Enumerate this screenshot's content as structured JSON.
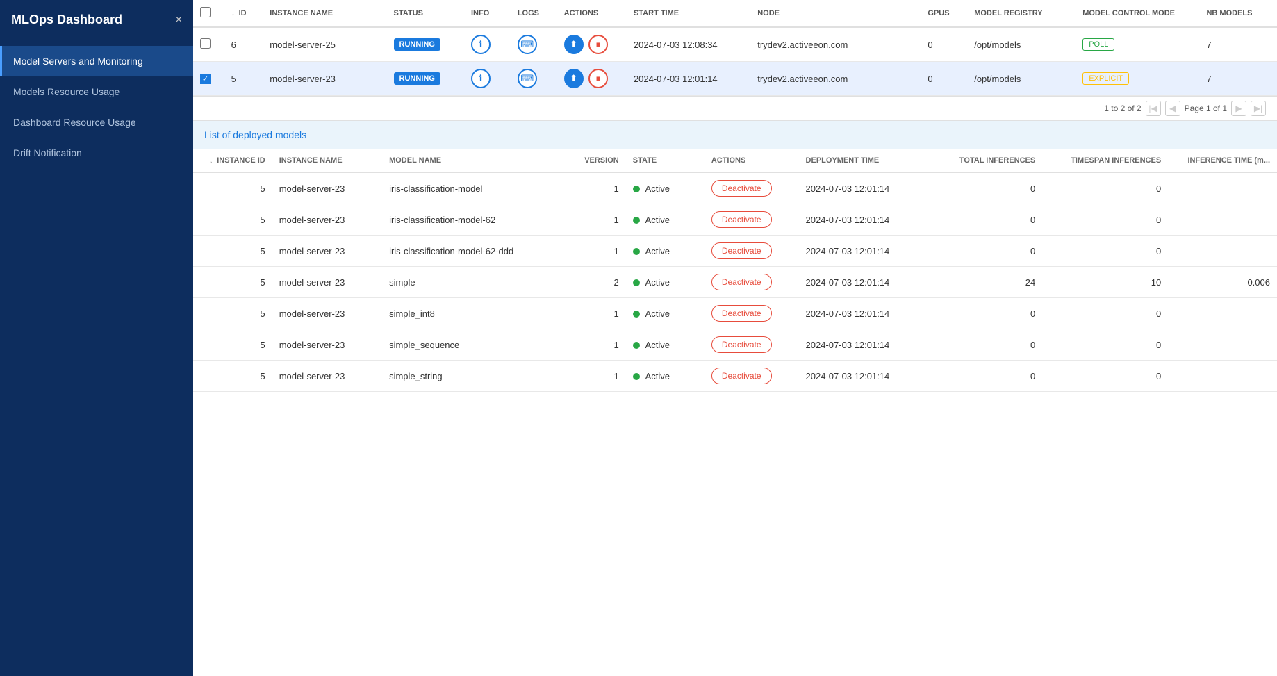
{
  "sidebar": {
    "title": "MLOps Dashboard",
    "close_label": "×",
    "items": [
      {
        "id": "model-servers",
        "label": "Model Servers and Monitoring",
        "active": true
      },
      {
        "id": "models-resource",
        "label": "Models Resource Usage",
        "active": false
      },
      {
        "id": "dashboard-resource",
        "label": "Dashboard Resource Usage",
        "active": false
      },
      {
        "id": "drift-notification",
        "label": "Drift Notification",
        "active": false
      }
    ]
  },
  "top_table": {
    "columns": [
      {
        "id": "checkbox",
        "label": ""
      },
      {
        "id": "id",
        "label": "ID",
        "sortable": true
      },
      {
        "id": "instance_name",
        "label": "INSTANCE NAME"
      },
      {
        "id": "status",
        "label": "STATUS"
      },
      {
        "id": "info",
        "label": "INFO"
      },
      {
        "id": "logs",
        "label": "LOGS"
      },
      {
        "id": "actions",
        "label": "ACTIONS"
      },
      {
        "id": "start_time",
        "label": "START TIME"
      },
      {
        "id": "node",
        "label": "NODE"
      },
      {
        "id": "gpus",
        "label": "GPUS"
      },
      {
        "id": "model_registry",
        "label": "MODEL REGISTRY"
      },
      {
        "id": "control_mode",
        "label": "MODEL CONTROL MODE"
      },
      {
        "id": "nb_models",
        "label": "NB MODELS"
      }
    ],
    "rows": [
      {
        "id": 6,
        "instance_name": "model-server-25",
        "status": "RUNNING",
        "start_time": "2024-07-03 12:08:34",
        "node": "trydev2.activeeon.com",
        "gpus": 0,
        "model_registry": "/opt/models",
        "control_mode": "POLL",
        "control_mode_type": "poll",
        "nb_models": 7,
        "selected": false
      },
      {
        "id": 5,
        "instance_name": "model-server-23",
        "status": "RUNNING",
        "start_time": "2024-07-03 12:01:14",
        "node": "trydev2.activeeon.com",
        "gpus": 0,
        "model_registry": "/opt/models",
        "control_mode": "EXPLICIT",
        "control_mode_type": "explicit",
        "nb_models": 7,
        "selected": true
      }
    ],
    "pagination": {
      "range": "1 to 2 of 2",
      "page_label": "Page 1 of 1"
    }
  },
  "deployed_models": {
    "section_title": "List of deployed models",
    "columns": [
      {
        "id": "instance_id",
        "label": "INSTANCE ID",
        "sortable": true
      },
      {
        "id": "instance_name",
        "label": "INSTANCE NAME"
      },
      {
        "id": "model_name",
        "label": "MODEL NAME"
      },
      {
        "id": "version",
        "label": "VERSION"
      },
      {
        "id": "state",
        "label": "STATE"
      },
      {
        "id": "actions",
        "label": "ACTIONS"
      },
      {
        "id": "deployment_time",
        "label": "DEPLOYMENT TIME"
      },
      {
        "id": "total_inferences",
        "label": "TOTAL INFERENCES"
      },
      {
        "id": "timespan_inferences",
        "label": "TIMESPAN INFERENCES"
      },
      {
        "id": "inference_time",
        "label": "INFERENCE TIME (m..."
      }
    ],
    "rows": [
      {
        "instance_id": 5,
        "instance_name": "model-server-23",
        "model_name": "iris-classification-model",
        "version": 1,
        "state": "Active",
        "deployment_time": "2024-07-03 12:01:14",
        "total_inferences": 0,
        "timespan_inferences": 0,
        "inference_time": ""
      },
      {
        "instance_id": 5,
        "instance_name": "model-server-23",
        "model_name": "iris-classification-model-62",
        "version": 1,
        "state": "Active",
        "deployment_time": "2024-07-03 12:01:14",
        "total_inferences": 0,
        "timespan_inferences": 0,
        "inference_time": ""
      },
      {
        "instance_id": 5,
        "instance_name": "model-server-23",
        "model_name": "iris-classification-model-62-ddd",
        "version": 1,
        "state": "Active",
        "deployment_time": "2024-07-03 12:01:14",
        "total_inferences": 0,
        "timespan_inferences": 0,
        "inference_time": ""
      },
      {
        "instance_id": 5,
        "instance_name": "model-server-23",
        "model_name": "simple",
        "version": 2,
        "state": "Active",
        "deployment_time": "2024-07-03 12:01:14",
        "total_inferences": 24,
        "timespan_inferences": 10,
        "inference_time": "0.006"
      },
      {
        "instance_id": 5,
        "instance_name": "model-server-23",
        "model_name": "simple_int8",
        "version": 1,
        "state": "Active",
        "deployment_time": "2024-07-03 12:01:14",
        "total_inferences": 0,
        "timespan_inferences": 0,
        "inference_time": ""
      },
      {
        "instance_id": 5,
        "instance_name": "model-server-23",
        "model_name": "simple_sequence",
        "version": 1,
        "state": "Active",
        "deployment_time": "2024-07-03 12:01:14",
        "total_inferences": 0,
        "timespan_inferences": 0,
        "inference_time": ""
      },
      {
        "instance_id": 5,
        "instance_name": "model-server-23",
        "model_name": "simple_string",
        "version": 1,
        "state": "Active",
        "deployment_time": "2024-07-03 12:01:14",
        "total_inferences": 0,
        "timespan_inferences": 0,
        "inference_time": ""
      }
    ],
    "deactivate_label": "Deactivate"
  }
}
